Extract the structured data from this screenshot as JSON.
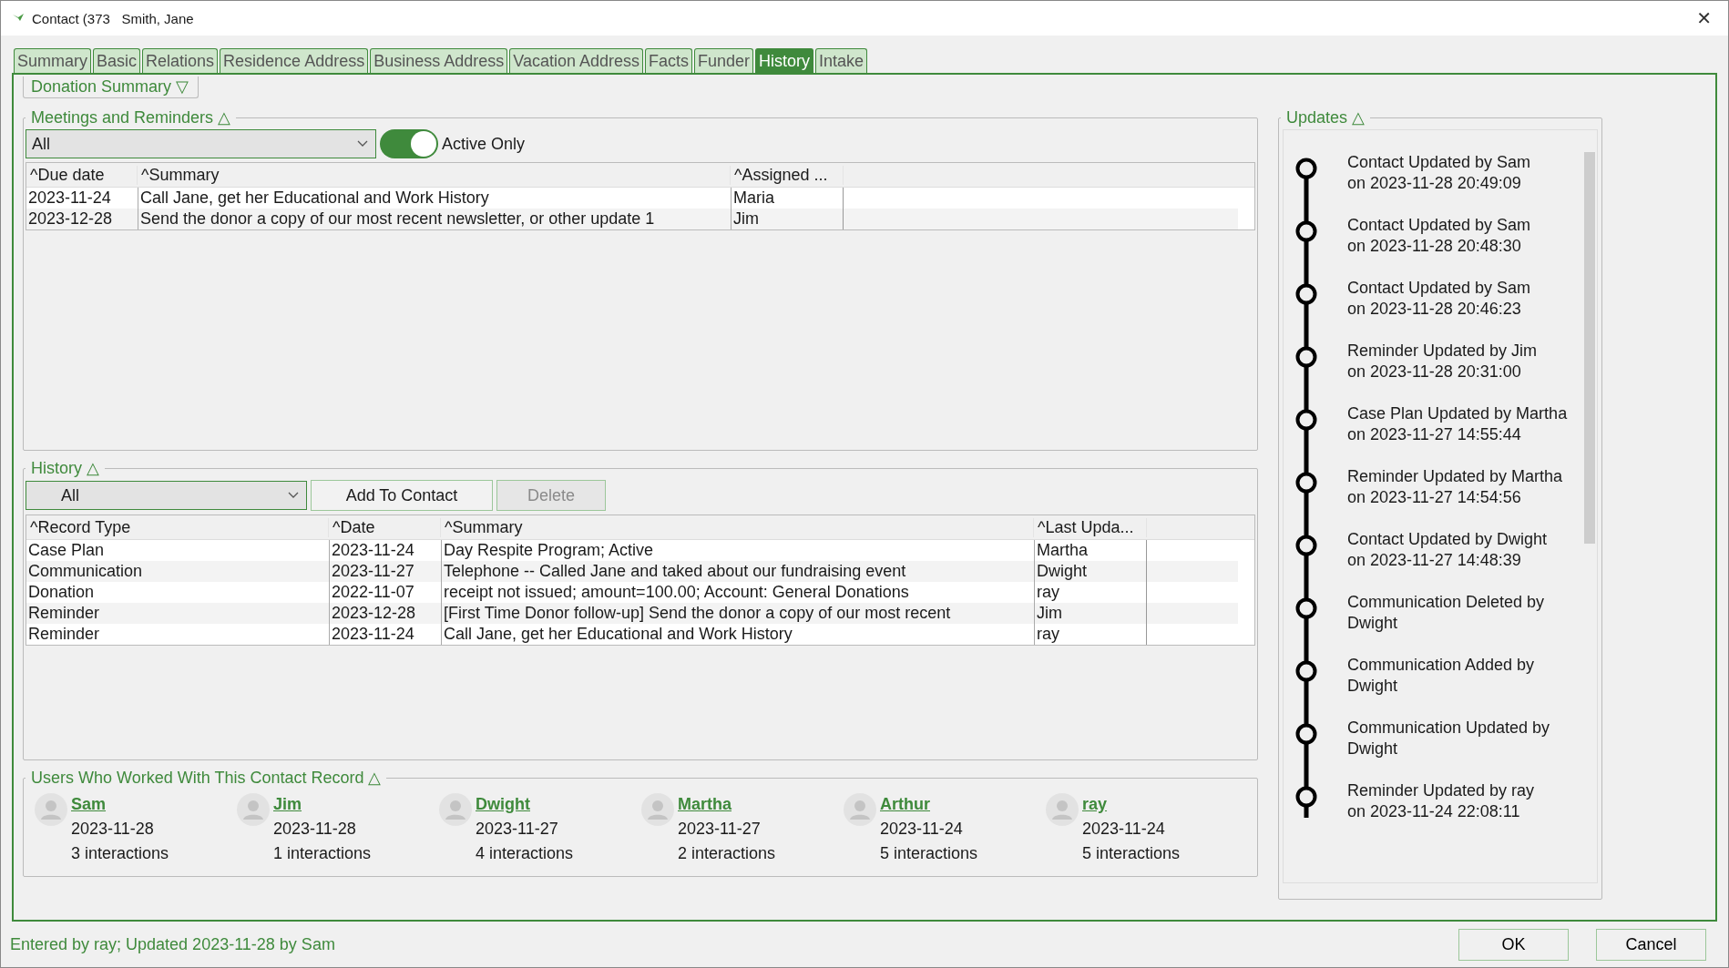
{
  "window": {
    "title": "Contact (373   Smith, Jane",
    "close": "✕"
  },
  "tabs": [
    {
      "label": "Summary",
      "selected": false
    },
    {
      "label": "Basic",
      "selected": false
    },
    {
      "label": "Relations",
      "selected": false
    },
    {
      "label": "Residence Address",
      "selected": false
    },
    {
      "label": "Business Address",
      "selected": false
    },
    {
      "label": "Vacation Address",
      "selected": false
    },
    {
      "label": "Facts",
      "selected": false
    },
    {
      "label": "Funder",
      "selected": false
    },
    {
      "label": "History",
      "selected": true
    },
    {
      "label": "Intake",
      "selected": false
    }
  ],
  "donation_summary": {
    "title": "Donation Summary",
    "toggle": "▽"
  },
  "meetings": {
    "title": "Meetings and Reminders",
    "toggle": "△",
    "filter": {
      "value": "All"
    },
    "active_only": {
      "label": "Active Only",
      "on": true
    },
    "table": {
      "columns": [
        "^Due date",
        "^Summary",
        "^Assigned ..."
      ],
      "rows": [
        [
          "2023-11-24",
          "Call Jane, get her Educational and Work History",
          "Maria"
        ],
        [
          "2023-12-28",
          "Send the donor a copy of our most recent newsletter, or other update 1",
          "Jim"
        ]
      ]
    }
  },
  "history": {
    "title": "History",
    "toggle": "△",
    "filter": {
      "value": "All"
    },
    "buttons": [
      {
        "label": "Add To Contact",
        "disabled": false
      },
      {
        "label": "Delete",
        "disabled": true
      }
    ],
    "table": {
      "columns": [
        "^Record Type",
        "^Date",
        "^Summary",
        "^Last Upda..."
      ],
      "rows": [
        [
          "Case Plan",
          "2023-11-24",
          "Day Respite Program; Active",
          "Martha"
        ],
        [
          "Communication",
          "2023-11-27",
          "Telephone -- Called Jane and taked about our fundraising event",
          "Dwight"
        ],
        [
          "Donation",
          "2022-11-07",
          "receipt not issued; amount=100.00; Account: General Donations",
          "ray"
        ],
        [
          "Reminder",
          "2023-12-28",
          "[First Time Donor follow-up] Send the donor a copy of our most recent",
          "Jim"
        ],
        [
          "Reminder",
          "2023-11-24",
          "Call Jane, get her Educational and Work History",
          "ray"
        ]
      ]
    }
  },
  "users": {
    "title": "Users Who Worked With This Contact Record",
    "toggle": "△",
    "items": [
      {
        "name": "Sam",
        "date": "2023-11-28",
        "interactions": "3 interactions"
      },
      {
        "name": "Jim",
        "date": "2023-11-28",
        "interactions": "1 interactions"
      },
      {
        "name": "Dwight",
        "date": "2023-11-27",
        "interactions": "4 interactions"
      },
      {
        "name": "Martha",
        "date": "2023-11-27",
        "interactions": "2 interactions"
      },
      {
        "name": "Arthur",
        "date": "2023-11-24",
        "interactions": "5 interactions"
      },
      {
        "name": "ray",
        "date": "2023-11-24",
        "interactions": "5 interactions"
      }
    ]
  },
  "updates": {
    "title": "Updates",
    "toggle": "△",
    "items": [
      "Contact Updated by Sam\non 2023-11-28 20:49:09",
      "Contact Updated by Sam\non 2023-11-28 20:48:30",
      "Contact Updated by Sam\non 2023-11-28 20:46:23",
      "Reminder Updated by Jim\non 2023-11-28 20:31:00",
      "Case Plan Updated by Martha\non 2023-11-27 14:55:44",
      "Reminder Updated by Martha\non 2023-11-27 14:54:56",
      "Contact Updated by Dwight\non 2023-11-27 14:48:39",
      "Communication Deleted by\nDwight",
      "Communication Added by\nDwight",
      "Communication Updated by\nDwight",
      "Reminder Updated by ray\non 2023-11-24 22:08:11"
    ]
  },
  "status": "Entered by ray; Updated 2023-11-28 by Sam",
  "buttons": [
    "OK",
    "Cancel"
  ]
}
